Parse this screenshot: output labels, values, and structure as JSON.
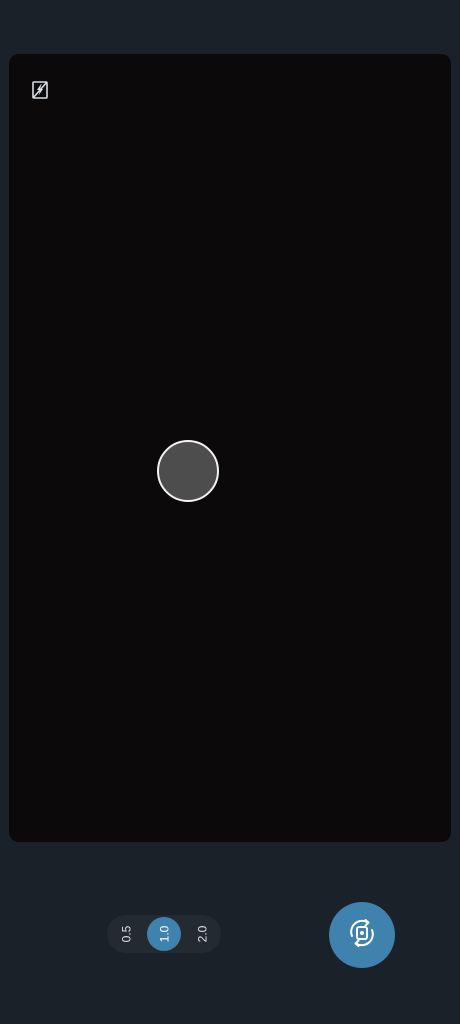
{
  "camera": {
    "flash_icon": "flash-off-icon",
    "shutter_icon": "shutter-button",
    "switch_camera_icon": "switch-camera-icon"
  },
  "zoom": {
    "options": [
      "0.5",
      "1.0",
      "2.0"
    ],
    "selected": "1.0"
  },
  "colors": {
    "background": "#1b2128",
    "viewfinder": "#0b0909",
    "accent": "#3e82ad",
    "shutter_fill": "#4e4d4e"
  }
}
